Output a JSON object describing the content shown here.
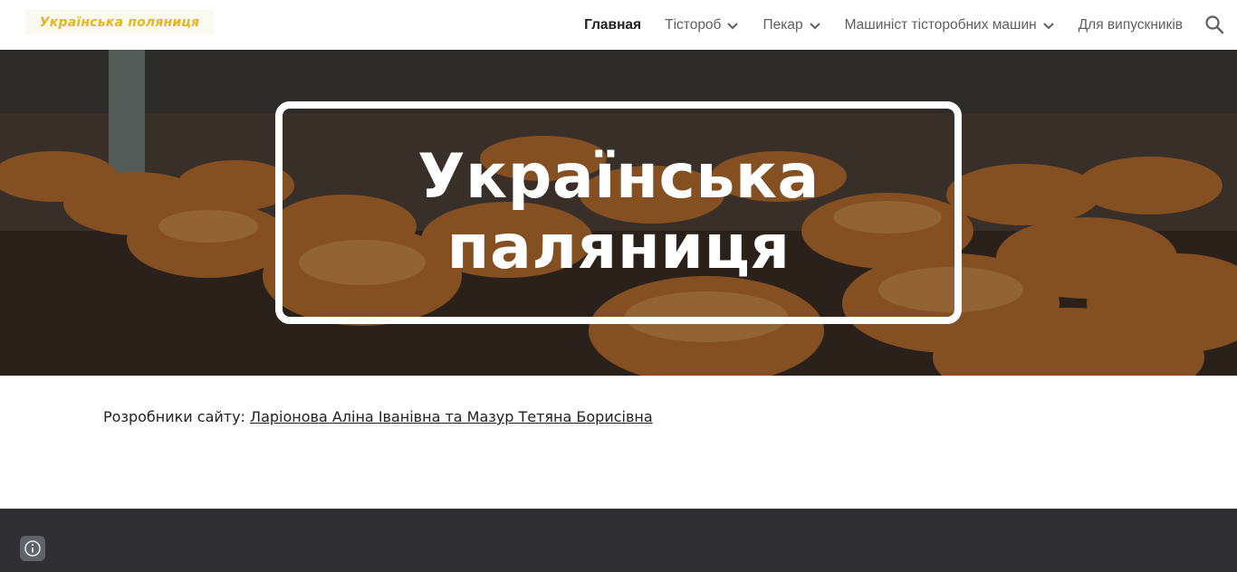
{
  "header": {
    "logo_text": "Українська поляниця",
    "nav": [
      {
        "label": "Главная",
        "active": true,
        "has_dropdown": false
      },
      {
        "label": "Тістороб",
        "active": false,
        "has_dropdown": true
      },
      {
        "label": "Пекар",
        "active": false,
        "has_dropdown": true
      },
      {
        "label": "Машиніст тісторобних машин",
        "active": false,
        "has_dropdown": true
      },
      {
        "label": "Для випускників",
        "active": false,
        "has_dropdown": false
      }
    ],
    "search_icon": "search-icon"
  },
  "hero": {
    "title_line1": "Українська",
    "title_line2": "паляниця"
  },
  "content": {
    "developers_label": "Розробники сайту:",
    "developers_link": "Ларіонова Аліна Іванівна та Мазур Тетяна Борисівна"
  },
  "footer": {
    "info_icon": "info-icon"
  },
  "colors": {
    "logo_text": "#e6b42a",
    "footer_bg": "#2e2e33",
    "nav_text": "#5f5f5f",
    "nav_active": "#212121"
  }
}
